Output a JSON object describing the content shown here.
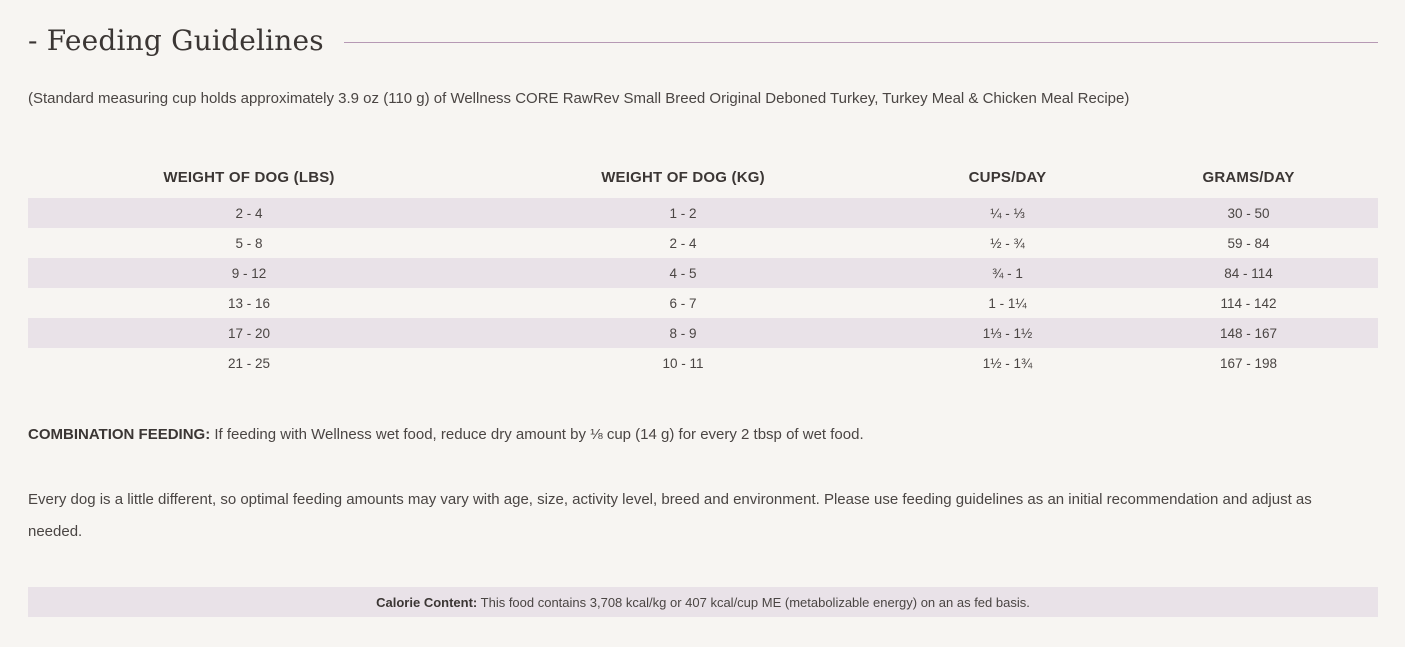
{
  "section": {
    "title": "- Feeding Guidelines",
    "note": "(Standard measuring cup holds approximately 3.9 oz (110 g) of Wellness CORE RawRev Small Breed Original Deboned Turkey, Turkey Meal & Chicken Meal Recipe)"
  },
  "table": {
    "headers": [
      "WEIGHT OF DOG (LBS)",
      "WEIGHT OF DOG (KG)",
      "CUPS/DAY",
      "GRAMS/DAY"
    ],
    "rows": [
      [
        "2 - 4",
        "1 - 2",
        "¼ - ⅓",
        "30 - 50"
      ],
      [
        "5 - 8",
        "2 - 4",
        "½ - ¾",
        "59 - 84"
      ],
      [
        "9 - 12",
        "4 - 5",
        "¾ - 1",
        "84 - 114"
      ],
      [
        "13 - 16",
        "6 - 7",
        "1 - 1¼",
        "114 - 142"
      ],
      [
        "17 - 20",
        "8 - 9",
        "1⅓ - 1½",
        "148 - 167"
      ],
      [
        "21 - 25",
        "10 - 11",
        "1½ - 1¾",
        "167 - 198"
      ]
    ]
  },
  "combination": {
    "label": "COMBINATION FEEDING:",
    "text": " If feeding with Wellness wet food, reduce dry amount by ⅛ cup (14 g) for every 2 tbsp of wet food."
  },
  "disclaimer": "Every dog is a little different, so optimal feeding amounts may vary with age, size, activity level, breed and environment. Please use feeding guidelines as an initial recommendation and adjust as needed.",
  "calorie": {
    "label": "Calorie Content:",
    "text": " This food contains 3,708 kcal/kg or 407 kcal/cup ME (metabolizable energy) on an as fed basis."
  },
  "colors": {
    "background": "#f7f5f2",
    "row_shade": "#e9e2e8",
    "rule": "#b699b4",
    "text": "#3b3634"
  }
}
